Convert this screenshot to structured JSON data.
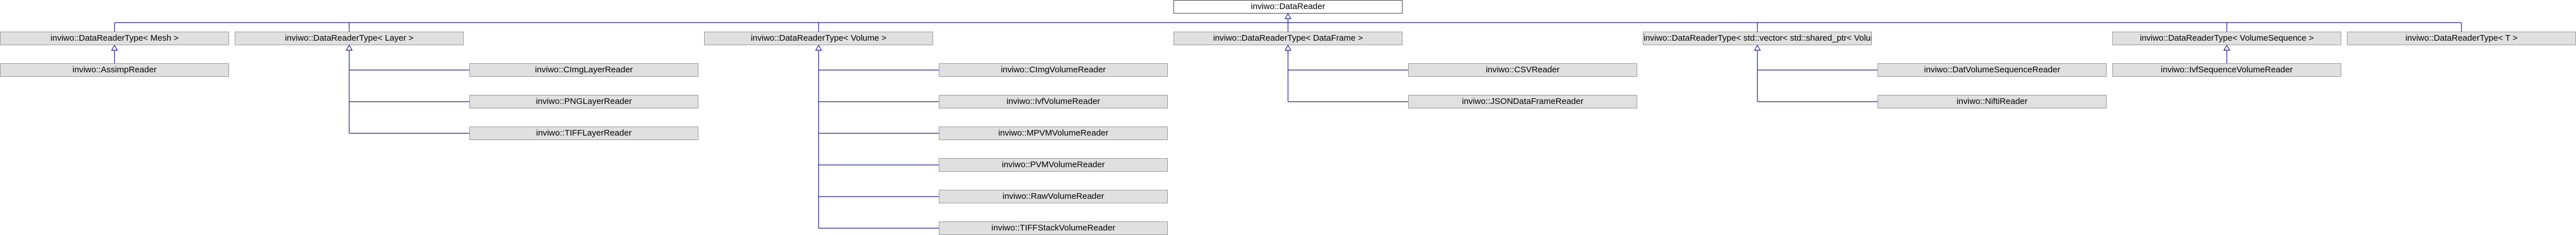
{
  "diagram": {
    "colors": {
      "edge": "#1a1a8c",
      "node_fill": "#e0e0e0",
      "node_border": "#999999",
      "root_fill": "#ffffff",
      "root_border": "#444444"
    },
    "nodes": [
      {
        "id": "datareader",
        "label": "inviwo::DataReader"
      },
      {
        "id": "dr-mesh",
        "label": "inviwo::DataReaderType< Mesh >"
      },
      {
        "id": "dr-layer",
        "label": "inviwo::DataReaderType< Layer >"
      },
      {
        "id": "dr-volume",
        "label": "inviwo::DataReaderType< Volume >"
      },
      {
        "id": "dr-dataframe",
        "label": "inviwo::DataReaderType< DataFrame >"
      },
      {
        "id": "dr-vector-volume",
        "label": "inviwo::DataReaderType< std::vector< std::shared_ptr< Volume > > >"
      },
      {
        "id": "dr-volumesequence",
        "label": "inviwo::DataReaderType< VolumeSequence >"
      },
      {
        "id": "dr-t",
        "label": "inviwo::DataReaderType< T >"
      },
      {
        "id": "assimpreader",
        "label": "inviwo::AssimpReader"
      },
      {
        "id": "cimglayerreader",
        "label": "inviwo::CImgLayerReader"
      },
      {
        "id": "pnglayerreader",
        "label": "inviwo::PNGLayerReader"
      },
      {
        "id": "tifflayerreader",
        "label": "inviwo::TIFFLayerReader"
      },
      {
        "id": "cimgvolumereader",
        "label": "inviwo::CImgVolumeReader"
      },
      {
        "id": "ivfvolumereader",
        "label": "inviwo::IvfVolumeReader"
      },
      {
        "id": "mpvmvolumereader",
        "label": "inviwo::MPVMVolumeReader"
      },
      {
        "id": "pvmvolumereader",
        "label": "inviwo::PVMVolumeReader"
      },
      {
        "id": "rawvolumereader",
        "label": "inviwo::RawVolumeReader"
      },
      {
        "id": "tiffstackvolumereader",
        "label": "inviwo::TIFFStackVolumeReader"
      },
      {
        "id": "csvreader",
        "label": "inviwo::CSVReader"
      },
      {
        "id": "jsondataframereader",
        "label": "inviwo::JSONDataFrameReader"
      },
      {
        "id": "datvolumesequencereader",
        "label": "inviwo::DatVolumeSequenceReader"
      },
      {
        "id": "niftireader",
        "label": "inviwo::NiftiReader"
      },
      {
        "id": "ivfsequencevolumereader",
        "label": "inviwo::IvfSequenceVolumeReader"
      }
    ],
    "edges": [
      {
        "from": "dr-mesh",
        "to": "datareader"
      },
      {
        "from": "dr-layer",
        "to": "datareader"
      },
      {
        "from": "dr-volume",
        "to": "datareader"
      },
      {
        "from": "dr-dataframe",
        "to": "datareader"
      },
      {
        "from": "dr-vector-volume",
        "to": "datareader"
      },
      {
        "from": "dr-volumesequence",
        "to": "datareader"
      },
      {
        "from": "dr-t",
        "to": "datareader"
      },
      {
        "from": "assimpreader",
        "to": "dr-mesh"
      },
      {
        "from": "cimglayerreader",
        "to": "dr-layer"
      },
      {
        "from": "pnglayerreader",
        "to": "dr-layer"
      },
      {
        "from": "tifflayerreader",
        "to": "dr-layer"
      },
      {
        "from": "cimgvolumereader",
        "to": "dr-volume"
      },
      {
        "from": "ivfvolumereader",
        "to": "dr-volume"
      },
      {
        "from": "mpvmvolumereader",
        "to": "dr-volume"
      },
      {
        "from": "pvmvolumereader",
        "to": "dr-volume"
      },
      {
        "from": "rawvolumereader",
        "to": "dr-volume"
      },
      {
        "from": "tiffstackvolumereader",
        "to": "dr-volume"
      },
      {
        "from": "csvreader",
        "to": "dr-dataframe"
      },
      {
        "from": "jsondataframereader",
        "to": "dr-dataframe"
      },
      {
        "from": "datvolumesequencereader",
        "to": "dr-vector-volume"
      },
      {
        "from": "niftireader",
        "to": "dr-vector-volume"
      },
      {
        "from": "ivfsequencevolumereader",
        "to": "dr-volumesequence"
      }
    ]
  }
}
